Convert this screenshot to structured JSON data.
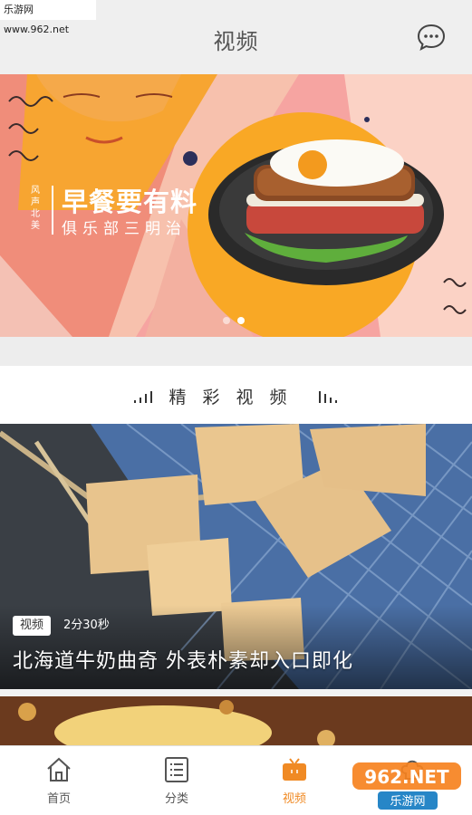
{
  "watermark_top": "乐游网 www.962.net",
  "header": {
    "title": "视频",
    "message_icon": "chat-bubble-icon"
  },
  "banner": {
    "tag": "风声北美",
    "headline": "早餐要有料",
    "subtitle": "俱乐部三明治",
    "dots": 2,
    "active_dot": 1
  },
  "section": {
    "title": "精彩视频"
  },
  "video": {
    "badge": "视频",
    "duration": "2分30秒",
    "title": "北海道牛奶曲奇 外表朴素却入口即化"
  },
  "tabs": [
    {
      "label": "首页",
      "icon": "home-icon",
      "active": false
    },
    {
      "label": "分类",
      "icon": "list-icon",
      "active": false
    },
    {
      "label": "视频",
      "icon": "tv-icon",
      "active": true
    },
    {
      "label": "",
      "icon": "chef-hat-icon",
      "active": false
    }
  ],
  "colors": {
    "accent": "#f08a24",
    "header_bg": "#efefef"
  },
  "watermark_bottom": {
    "logo": "962.NET",
    "text": "乐游网"
  }
}
